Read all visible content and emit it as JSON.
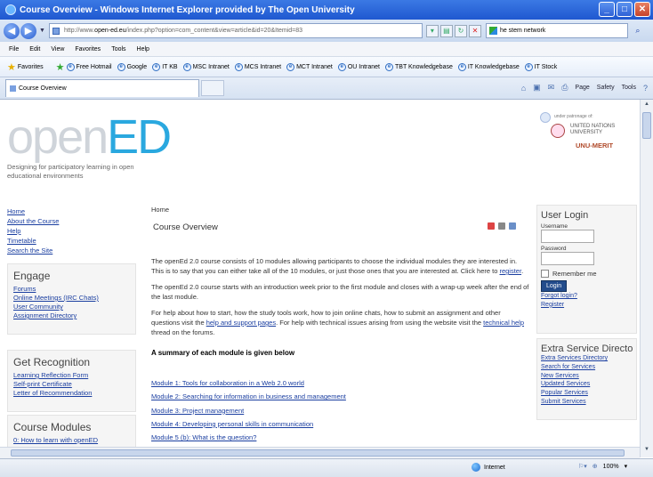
{
  "browser": {
    "title": "Course Overview - Windows Internet Explorer provided by The Open University",
    "address_prefix": "http://www.",
    "address_host": "open-ed.eu",
    "address_path": "/index.php?option=com_content&view=article&id=20&Itemid=83",
    "search_value": "he stem network",
    "menu": [
      "File",
      "Edit",
      "View",
      "Favorites",
      "Tools",
      "Help"
    ],
    "favorites_label": "Favorites",
    "links": [
      "Free Hotmail",
      "Google",
      "IT KB",
      "MSC Intranet",
      "MCS Intranet",
      "MCT Intranet",
      "OU Intranet",
      "TBT Knowledgebase",
      "IT Knowledgebase",
      "IT Stock"
    ],
    "tab_label": "Course Overview",
    "command_bar": [
      "Page",
      "Safety",
      "Tools"
    ],
    "status_zone": "Internet",
    "status_zoom": "100%"
  },
  "page": {
    "logo_prefix": "open",
    "logo_suffix": "ED",
    "tagline": "Designing for participatory learning in open educational environments",
    "unu_under": "under patronage of:",
    "unu_line1": "UNITED NATIONS",
    "unu_line2": "UNIVERSITY",
    "unu_merit": "UNU-MERIT",
    "left_nav": [
      "Home",
      "About the Course",
      "Help",
      "Timetable",
      "Search the Site"
    ],
    "engage": {
      "title": "Engage",
      "links": [
        "Forums",
        "Online Meetings (IRC Chats)",
        "User Community",
        "Assignment Directory"
      ]
    },
    "recognition": {
      "title": "Get Recognition",
      "links": [
        "Learning Reflection Form",
        "Self-print Certificate",
        "Letter of Recommendation"
      ]
    },
    "modules_box": {
      "title": "Course Modules",
      "links": [
        "0: How to learn with openED"
      ]
    },
    "breadcrumb": "Home",
    "title": "Course Overview",
    "para1": "The openEd 2.0 course consists of 10 modules allowing participants to choose the individual modules they are interested in. This is to say that you can either take all of the 10 modules, or just those ones that you are interested at. Click here to ",
    "para1_link": "register",
    "para1_end": ".",
    "para2": "The openEd 2.0 course starts with an introduction week prior to the first module and closes with a wrap-up week after the end of the last module.",
    "para3a": "For help about how to start, how the study tools work, how to join online chats, how to submit an assignment and other questions visit the ",
    "para3_link1": "help and support pages",
    "para3b": ". For help with technical issues arising from using the website visit the ",
    "para3_link2": "technical help",
    "para3c": " thread on the forums.",
    "summary": "A summary of each module is given below",
    "modules": [
      "Module 1: Tools for collaboration in a Web 2.0 world",
      "Module 2: Searching for information in business and management",
      "Module 3: Project management",
      "Module 4: Developing personal skills in communication",
      "Module 5 (b): What is the question?"
    ],
    "login": {
      "title": "User Login",
      "username_label": "Username",
      "password_label": "Password",
      "remember": "Remember me",
      "button": "Login",
      "forgot": "Forgot login?",
      "register": "Register"
    },
    "extra": {
      "title": "Extra Service Directory",
      "links": [
        "Extra Services Directory",
        "Search for Services",
        "New Services",
        "Updated Services",
        "Popular Services",
        "Submit Services"
      ]
    }
  }
}
